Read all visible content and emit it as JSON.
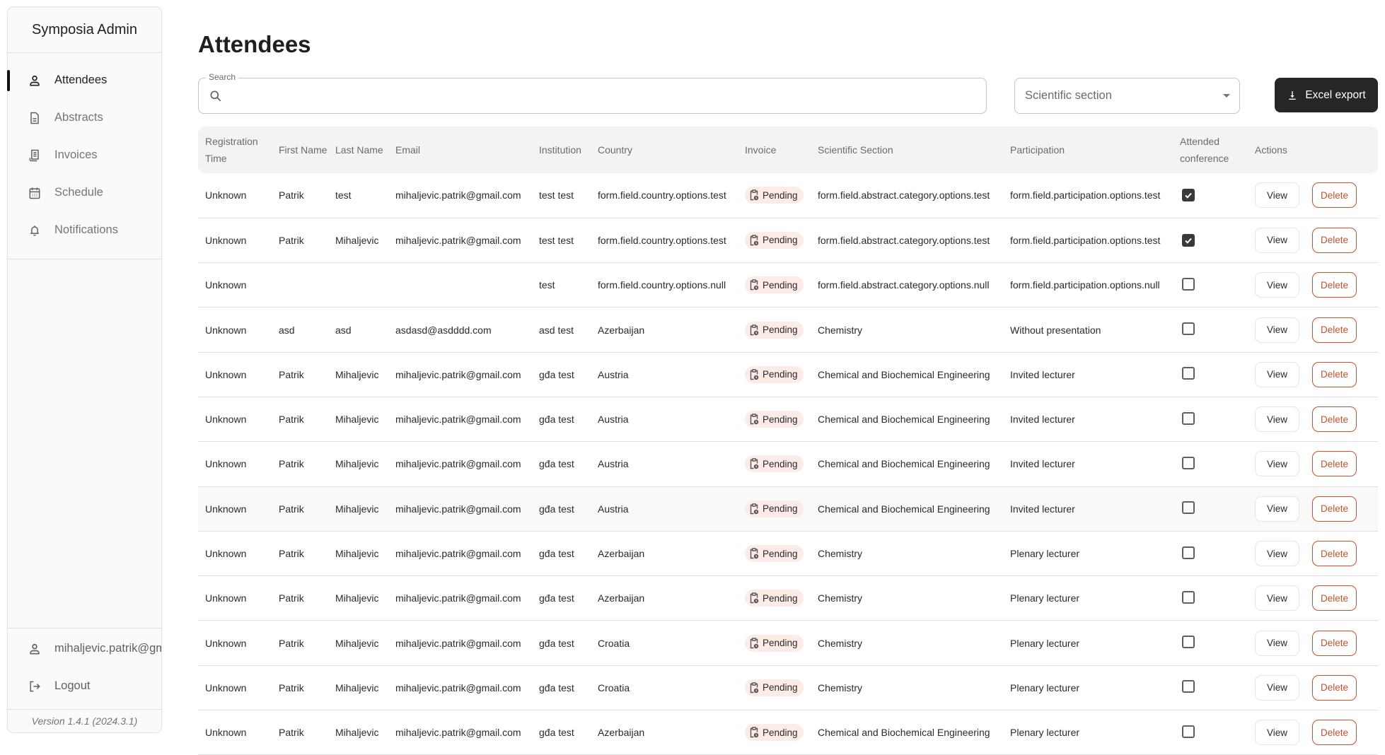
{
  "sidebar": {
    "brand": "Symposia Admin",
    "items": [
      {
        "label": "Attendees",
        "icon": "person-icon",
        "active": true
      },
      {
        "label": "Abstracts",
        "icon": "document-icon",
        "active": false
      },
      {
        "label": "Invoices",
        "icon": "receipt-icon",
        "active": false
      },
      {
        "label": "Schedule",
        "icon": "calendar-icon",
        "active": false
      },
      {
        "label": "Notifications",
        "icon": "bell-icon",
        "active": false
      }
    ],
    "user_email": "mihaljevic.patrik@gmail.com",
    "logout_label": "Logout",
    "version": "Version 1.4.1 (2024.3.1)"
  },
  "page": {
    "title": "Attendees",
    "search": {
      "label": "Search",
      "value": "",
      "placeholder": ""
    },
    "section_select": {
      "placeholder": "Scientific section",
      "value": ""
    },
    "export_label": "Excel export"
  },
  "table": {
    "columns": [
      "Registration Time",
      "First Name",
      "Last Name",
      "Email",
      "Institution",
      "Country",
      "Invoice",
      "Scientific Section",
      "Participation",
      "Attended conference",
      "Actions"
    ],
    "view_label": "View",
    "delete_label": "Delete",
    "rows": [
      {
        "registration_time": "Unknown",
        "first_name": "Patrik",
        "last_name": "test",
        "email": "mihaljevic.patrik@gmail.com",
        "institution": "test test",
        "country": "form.field.country.options.test",
        "invoice": "Pending",
        "section": "form.field.abstract.category.options.test",
        "participation": "form.field.participation.options.test",
        "attended": true
      },
      {
        "registration_time": "Unknown",
        "first_name": "Patrik",
        "last_name": "Mihaljevic",
        "email": "mihaljevic.patrik@gmail.com",
        "institution": "test test",
        "country": "form.field.country.options.test",
        "invoice": "Pending",
        "section": "form.field.abstract.category.options.test",
        "participation": "form.field.participation.options.test",
        "attended": true
      },
      {
        "registration_time": "Unknown",
        "first_name": "",
        "last_name": "",
        "email": "",
        "institution": "test",
        "country": "form.field.country.options.null",
        "invoice": "Pending",
        "section": "form.field.abstract.category.options.null",
        "participation": "form.field.participation.options.null",
        "attended": false
      },
      {
        "registration_time": "Unknown",
        "first_name": "asd",
        "last_name": "asd",
        "email": "asdasd@asdddd.com",
        "institution": "asd test",
        "country": "Azerbaijan",
        "invoice": "Pending",
        "section": "Chemistry",
        "participation": "Without presentation",
        "attended": false
      },
      {
        "registration_time": "Unknown",
        "first_name": "Patrik",
        "last_name": "Mihaljevic",
        "email": "mihaljevic.patrik@gmail.com",
        "institution": "gđa test",
        "country": "Austria",
        "invoice": "Pending",
        "section": "Chemical and Biochemical Engineering",
        "participation": "Invited lecturer",
        "attended": false
      },
      {
        "registration_time": "Unknown",
        "first_name": "Patrik",
        "last_name": "Mihaljevic",
        "email": "mihaljevic.patrik@gmail.com",
        "institution": "gđa test",
        "country": "Austria",
        "invoice": "Pending",
        "section": "Chemical and Biochemical Engineering",
        "participation": "Invited lecturer",
        "attended": false
      },
      {
        "registration_time": "Unknown",
        "first_name": "Patrik",
        "last_name": "Mihaljevic",
        "email": "mihaljevic.patrik@gmail.com",
        "institution": "gđa test",
        "country": "Austria",
        "invoice": "Pending",
        "section": "Chemical and Biochemical Engineering",
        "participation": "Invited lecturer",
        "attended": false
      },
      {
        "registration_time": "Unknown",
        "first_name": "Patrik",
        "last_name": "Mihaljevic",
        "email": "mihaljevic.patrik@gmail.com",
        "institution": "gđa test",
        "country": "Austria",
        "invoice": "Pending",
        "section": "Chemical and Biochemical Engineering",
        "participation": "Invited lecturer",
        "attended": false,
        "hovered": true
      },
      {
        "registration_time": "Unknown",
        "first_name": "Patrik",
        "last_name": "Mihaljevic",
        "email": "mihaljevic.patrik@gmail.com",
        "institution": "gđa test",
        "country": "Azerbaijan",
        "invoice": "Pending",
        "section": "Chemistry",
        "participation": "Plenary lecturer",
        "attended": false
      },
      {
        "registration_time": "Unknown",
        "first_name": "Patrik",
        "last_name": "Mihaljevic",
        "email": "mihaljevic.patrik@gmail.com",
        "institution": "gđa test",
        "country": "Azerbaijan",
        "invoice": "Pending",
        "section": "Chemistry",
        "participation": "Plenary lecturer",
        "attended": false
      },
      {
        "registration_time": "Unknown",
        "first_name": "Patrik",
        "last_name": "Mihaljevic",
        "email": "mihaljevic.patrik@gmail.com",
        "institution": "gđa test",
        "country": "Croatia",
        "invoice": "Pending",
        "section": "Chemistry",
        "participation": "Plenary lecturer",
        "attended": false
      },
      {
        "registration_time": "Unknown",
        "first_name": "Patrik",
        "last_name": "Mihaljevic",
        "email": "mihaljevic.patrik@gmail.com",
        "institution": "gđa test",
        "country": "Croatia",
        "invoice": "Pending",
        "section": "Chemistry",
        "participation": "Plenary lecturer",
        "attended": false
      },
      {
        "registration_time": "Unknown",
        "first_name": "Patrik",
        "last_name": "Mihaljevic",
        "email": "mihaljevic.patrik@gmail.com",
        "institution": "gđa test",
        "country": "Azerbaijan",
        "invoice": "Pending",
        "section": "Chemical and Biochemical Engineering",
        "participation": "Plenary lecturer",
        "attended": false
      }
    ]
  },
  "colors": {
    "primary_dark": "#262626",
    "delete_accent": "#c2522d",
    "pending_chip_bg": "#fdebe8",
    "header_bg": "#f3f3f3"
  }
}
